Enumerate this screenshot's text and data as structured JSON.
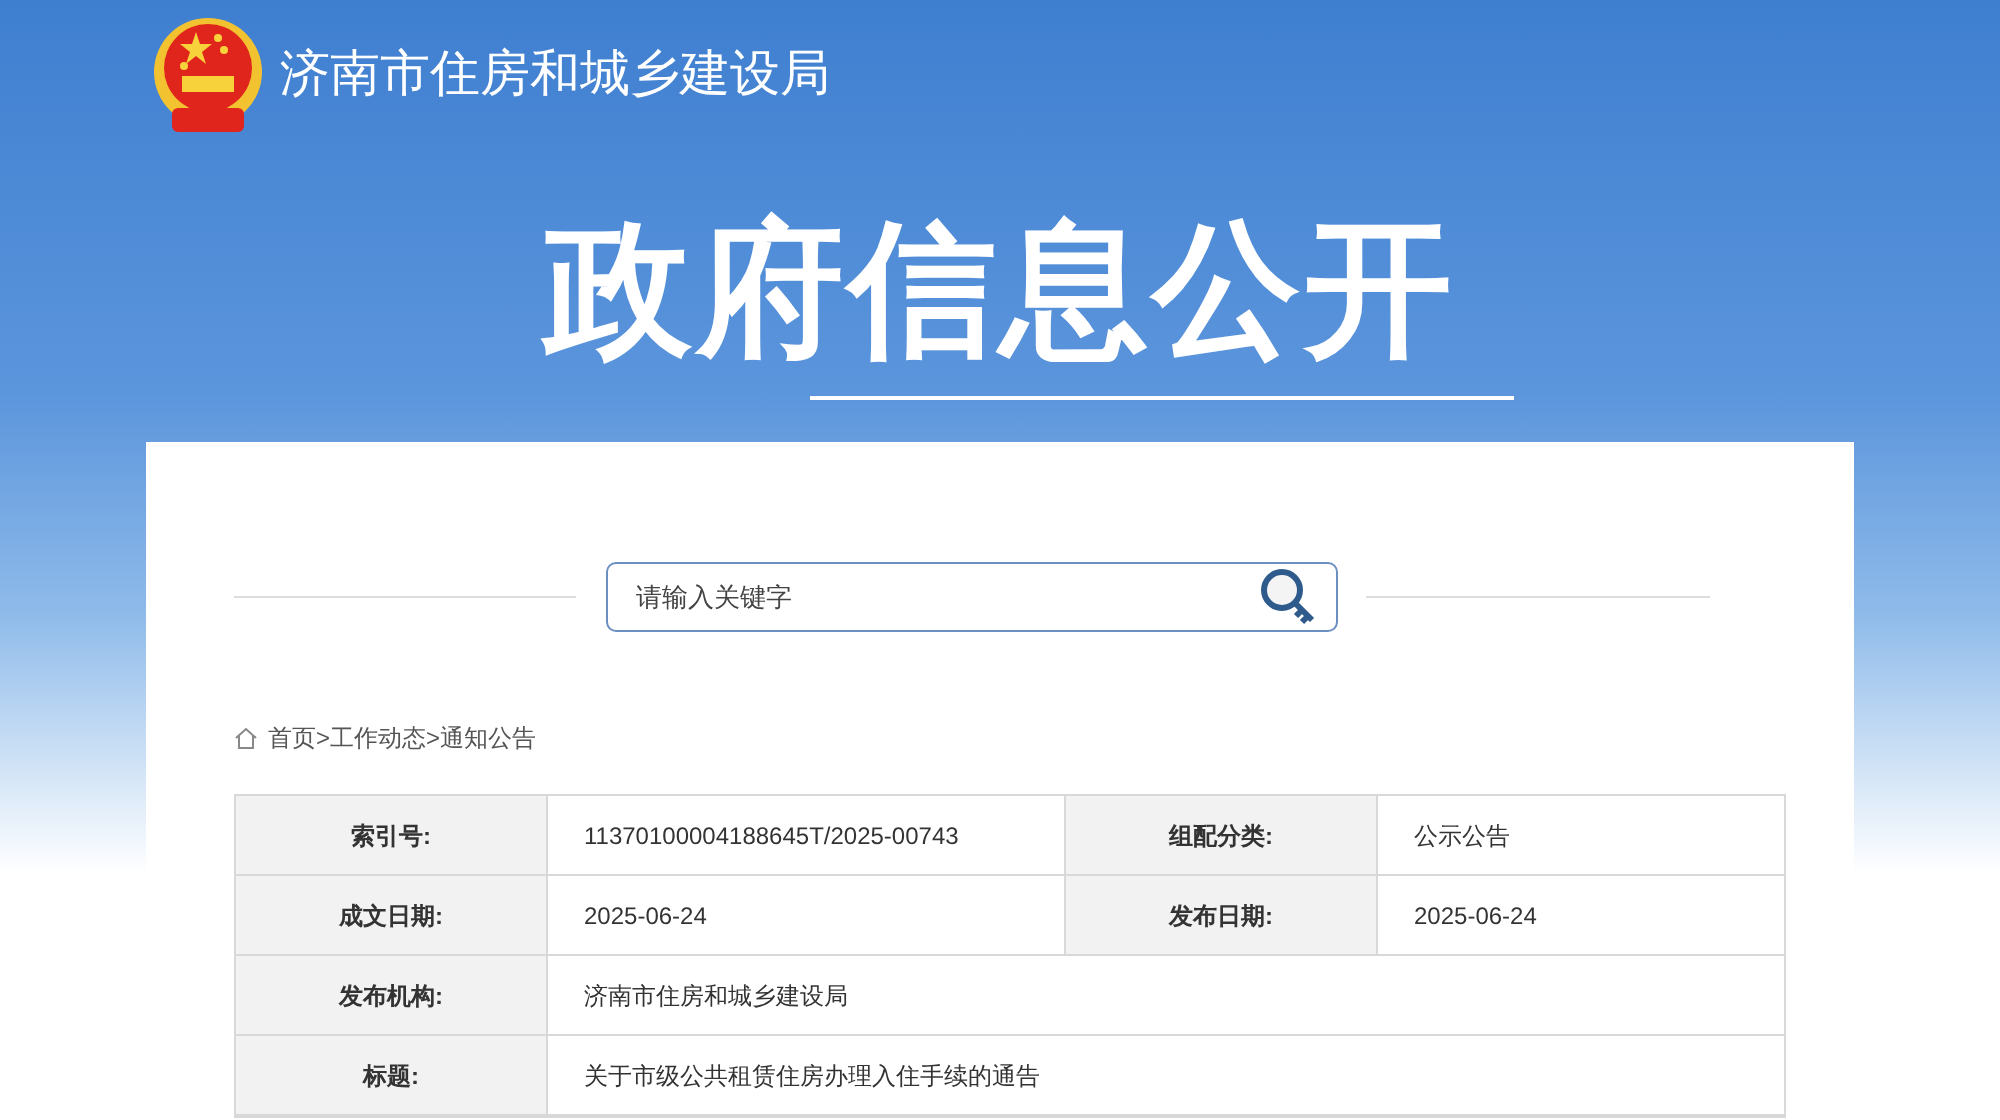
{
  "site_name": "济南市住房和城乡建设局",
  "page_title": "政府信息公开",
  "search": {
    "placeholder": "请输入关键字"
  },
  "breadcrumb": [
    "首页",
    ">",
    "工作动态",
    ">",
    "通知公告"
  ],
  "info_table": [
    {
      "fields": [
        {
          "label": "索引号:",
          "value": "11370100004188645T/2025-00743"
        },
        {
          "label": "组配分类:",
          "value": "公示公告"
        }
      ]
    },
    {
      "fields": [
        {
          "label": "成文日期:",
          "value": "2025-06-24"
        },
        {
          "label": "发布日期:",
          "value": "2025-06-24"
        }
      ]
    },
    {
      "fields": [
        {
          "label": "发布机构:",
          "value": "济南市住房和城乡建设局"
        }
      ]
    },
    {
      "fields": [
        {
          "label": "标题:",
          "value": "关于市级公共租赁住房办理入住手续的通告"
        }
      ]
    }
  ]
}
